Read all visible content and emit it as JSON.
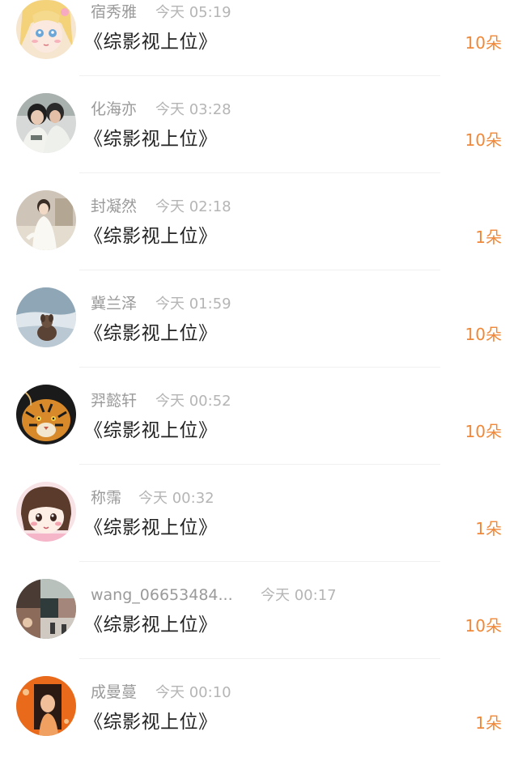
{
  "colors": {
    "gift_accent": "#f0883a",
    "name_gray": "#9a9a9a",
    "time_gray": "#b5b5b5",
    "title_black": "#222222",
    "divider": "#f0f0f0"
  },
  "items": [
    {
      "name": "宿秀雅",
      "time": "今天 05:19",
      "title": "《综影视上位》",
      "gift": "10朵",
      "avatar_icon": "anime-girl-avatar"
    },
    {
      "name": "化海亦",
      "time": "今天 03:28",
      "title": "《综影视上位》",
      "gift": "10朵",
      "avatar_icon": "couple-photo-avatar"
    },
    {
      "name": "封凝然",
      "time": "今天 02:18",
      "title": "《综影视上位》",
      "gift": "1朵",
      "avatar_icon": "person-white-dress-avatar"
    },
    {
      "name": "冀兰泽",
      "time": "今天 01:59",
      "title": "《综影视上位》",
      "gift": "10朵",
      "avatar_icon": "dog-seascape-avatar"
    },
    {
      "name": "羿懿轩",
      "time": "今天 00:52",
      "title": "《综影视上位》",
      "gift": "10朵",
      "avatar_icon": "tiger-avatar"
    },
    {
      "name": "称霈",
      "time": "今天 00:32",
      "title": "《综影视上位》",
      "gift": "1朵",
      "avatar_icon": "cartoon-girl-avatar"
    },
    {
      "name": "wang_06653484...",
      "time": "今天 00:17",
      "title": "《综影视上位》",
      "gift": "10朵",
      "avatar_icon": "collage-photo-avatar"
    },
    {
      "name": "成曼蔓",
      "time": "今天 00:10",
      "title": "《综影视上位》",
      "gift": "1朵",
      "avatar_icon": "orange-portrait-avatar"
    }
  ]
}
